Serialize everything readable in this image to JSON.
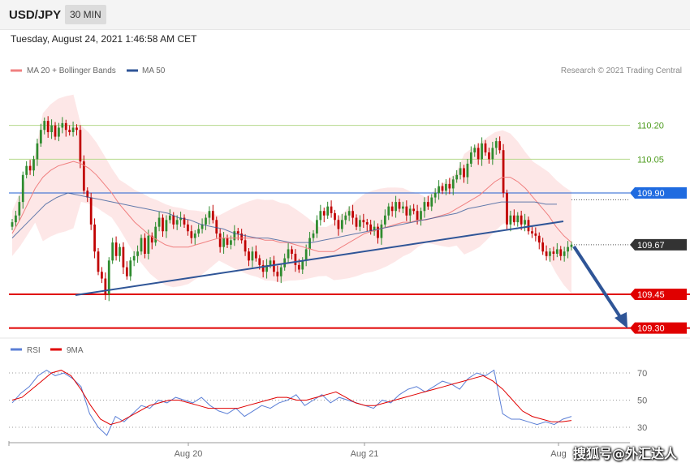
{
  "header": {
    "symbol": "USD/JPY",
    "timeframe": "30 MIN"
  },
  "timestamp": "Tuesday, August 24, 2021 1:46:58 AM CET",
  "legend": {
    "ma20_label": "MA 20 + Bollinger Bands",
    "ma50_label": "MA 50",
    "credit": "Research © 2021 Trading Central",
    "colors": {
      "ma20": "#f08080",
      "ma50": "#2f5597"
    }
  },
  "rsi_legend": {
    "rsi_label": "RSI",
    "ma_label": "9MA",
    "colors": {
      "rsi": "#5b7fd6",
      "ma": "#e00000"
    }
  },
  "watermark": "搜狐号@外汇达人",
  "chart_data": [
    {
      "type": "candlestick",
      "x_labels": [
        "Aug 20",
        "Aug 21",
        "Aug"
      ],
      "ylim": [
        109.2,
        110.33
      ],
      "price_labels": [
        {
          "value": 110.2,
          "text": "110.20",
          "style": "green-text"
        },
        {
          "value": 110.05,
          "text": "110.05",
          "style": "green-text"
        },
        {
          "value": 109.9,
          "text": "109.90",
          "style": "blue-box"
        },
        {
          "value": 109.67,
          "text": "109.67",
          "style": "dark-box"
        },
        {
          "value": 109.45,
          "text": "109.45",
          "style": "red-box"
        },
        {
          "value": 109.3,
          "text": "109.30",
          "style": "red-box"
        }
      ],
      "horizontal_lines": [
        {
          "value": 110.2,
          "color": "#b5d98b"
        },
        {
          "value": 110.05,
          "color": "#b5d98b"
        },
        {
          "value": 109.9,
          "color": "#1f5fd1"
        },
        {
          "value": 109.45,
          "color": "#e00000"
        },
        {
          "value": 109.3,
          "color": "#e00000"
        }
      ],
      "close": [
        109.77,
        109.8,
        109.86,
        109.98,
        110.02,
        110.0,
        110.05,
        110.12,
        110.18,
        110.22,
        110.17,
        110.2,
        110.15,
        110.19,
        110.21,
        110.18,
        110.17,
        110.19,
        110.18,
        110.04,
        109.91,
        109.88,
        109.76,
        109.64,
        109.55,
        109.52,
        109.45,
        109.6,
        109.68,
        109.62,
        109.66,
        109.57,
        109.53,
        109.6,
        109.62,
        109.64,
        109.7,
        109.63,
        109.71,
        109.68,
        109.75,
        109.79,
        109.73,
        109.78,
        109.8,
        109.76,
        109.78,
        109.79,
        109.76,
        109.73,
        109.7,
        109.72,
        109.74,
        109.76,
        109.79,
        109.82,
        109.78,
        109.72,
        109.66,
        109.7,
        109.67,
        109.69,
        109.73,
        109.72,
        109.69,
        109.64,
        109.6,
        109.64,
        109.61,
        109.58,
        109.55,
        109.58,
        109.6,
        109.55,
        109.53,
        109.57,
        109.61,
        109.65,
        109.63,
        109.58,
        109.56,
        109.6,
        109.65,
        109.7,
        109.72,
        109.78,
        109.82,
        109.8,
        109.84,
        109.81,
        109.78,
        109.74,
        109.78,
        109.8,
        109.82,
        109.79,
        109.75,
        109.78,
        109.77,
        109.76,
        109.73,
        109.75,
        109.7,
        109.76,
        109.8,
        109.84,
        109.82,
        109.86,
        109.83,
        109.84,
        109.8,
        109.83,
        109.82,
        109.78,
        109.82,
        109.86,
        109.84,
        109.88,
        109.9,
        109.93,
        109.91,
        109.94,
        109.92,
        109.96,
        109.98,
        110.01,
        109.97,
        110.03,
        110.08,
        110.1,
        110.05,
        110.12,
        110.08,
        110.05,
        110.1,
        110.13,
        110.09,
        109.9,
        109.76,
        109.8,
        109.77,
        109.8,
        109.76,
        109.78,
        109.73,
        109.72,
        109.71,
        109.68,
        109.64,
        109.62,
        109.64,
        109.63,
        109.65,
        109.62,
        109.64,
        109.66,
        109.67
      ],
      "ma20": [
        109.72,
        109.78,
        109.85,
        109.92,
        109.97,
        110.0,
        110.02,
        110.03,
        110.04,
        110.03,
        110.01,
        109.98,
        109.94,
        109.9,
        109.85,
        109.81,
        109.77,
        109.74,
        109.71,
        109.69,
        109.67,
        109.66,
        109.66,
        109.66,
        109.67,
        109.68,
        109.69,
        109.7,
        109.7,
        109.7,
        109.7,
        109.7,
        109.7,
        109.69,
        109.69,
        109.68,
        109.68,
        109.67,
        109.66,
        109.65,
        109.64,
        109.64,
        109.64,
        109.66,
        109.68,
        109.7,
        109.72,
        109.73,
        109.74,
        109.75,
        109.76,
        109.77,
        109.77,
        109.78,
        109.78,
        109.79,
        109.8,
        109.81,
        109.83,
        109.85,
        109.87,
        109.89,
        109.92,
        109.95,
        109.97,
        109.97,
        109.95,
        109.92,
        109.88,
        109.84,
        109.8,
        109.75,
        109.71,
        109.68
      ],
      "ma50": [
        109.7,
        109.75,
        109.8,
        109.85,
        109.88,
        109.9,
        109.89,
        109.88,
        109.87,
        109.86,
        109.85,
        109.84,
        109.83,
        109.82,
        109.81,
        109.79,
        109.78,
        109.76,
        109.75,
        109.74,
        109.72,
        109.71,
        109.7,
        109.7,
        109.69,
        109.68,
        109.68,
        109.68,
        109.69,
        109.7,
        109.71,
        109.72,
        109.73,
        109.74,
        109.75,
        109.76,
        109.77,
        109.78,
        109.79,
        109.8,
        109.81,
        109.83,
        109.84,
        109.85,
        109.86,
        109.86,
        109.86,
        109.86,
        109.85,
        109.85
      ]
    },
    {
      "type": "line",
      "title": "RSI",
      "ylim": [
        22,
        78
      ],
      "y_ticks": [
        70,
        50,
        30
      ],
      "series": [
        {
          "name": "RSI",
          "values": [
            48,
            55,
            60,
            68,
            72,
            68,
            70,
            66,
            60,
            40,
            30,
            24,
            38,
            34,
            40,
            46,
            44,
            50,
            48,
            52,
            50,
            48,
            52,
            46,
            42,
            40,
            44,
            38,
            42,
            46,
            44,
            48,
            50,
            54,
            46,
            50,
            54,
            48,
            52,
            50,
            48,
            46,
            44,
            50,
            48,
            54,
            58,
            60,
            56,
            60,
            64,
            62,
            58,
            66,
            70,
            68,
            72,
            40,
            36,
            36,
            34,
            32,
            34,
            32,
            36,
            38
          ]
        },
        {
          "name": "9MA",
          "values": [
            50,
            52,
            58,
            64,
            70,
            72,
            68,
            58,
            46,
            36,
            32,
            34,
            38,
            42,
            46,
            48,
            50,
            50,
            48,
            46,
            44,
            44,
            44,
            44,
            46,
            48,
            50,
            52,
            52,
            50,
            50,
            52,
            54,
            56,
            52,
            48,
            46,
            46,
            48,
            50,
            52,
            54,
            56,
            58,
            60,
            62,
            64,
            66,
            68,
            64,
            58,
            50,
            42,
            38,
            36,
            34,
            34,
            35
          ]
        }
      ]
    }
  ]
}
